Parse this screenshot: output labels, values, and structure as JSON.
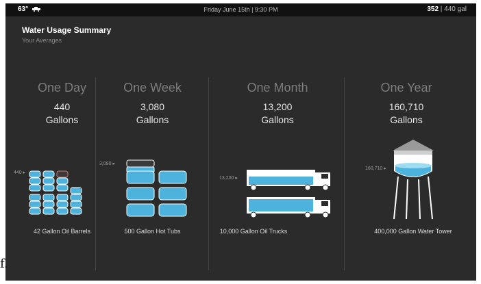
{
  "status_bar": {
    "temperature": "63°",
    "weather_icon": "car-icon",
    "datetime": "Friday June 15th | 9:30 PM",
    "usage_now": "352",
    "usage_rest": " | 440 gal"
  },
  "header": {
    "title": "Water Usage Summary",
    "subtitle": "Your Averages"
  },
  "columns": [
    {
      "period": "One Day",
      "amount": "440",
      "unit": "Gallons",
      "marker": "440",
      "caption": "42 Gallon Oil Barrels",
      "icon": "oil-barrel-icon"
    },
    {
      "period": "One Week",
      "amount": "3,080",
      "unit": "Gallons",
      "marker": "3,080",
      "caption": "500 Gallon Hot Tubs",
      "icon": "hot-tub-icon"
    },
    {
      "period": "One Month",
      "amount": "13,200",
      "unit": "Gallons",
      "marker": "13,200",
      "caption": "10,000 Gallon Oil Trucks",
      "icon": "oil-truck-icon"
    },
    {
      "period": "One Year",
      "amount": "160,710",
      "unit": "Gallons",
      "marker": "160,710",
      "caption": "400,000 Gallon Water Tower",
      "icon": "water-tower-icon"
    }
  ],
  "figure_label": "f.",
  "colors": {
    "accent": "#4db3dc",
    "background": "#2b2b2b",
    "topbar": "#111111"
  }
}
